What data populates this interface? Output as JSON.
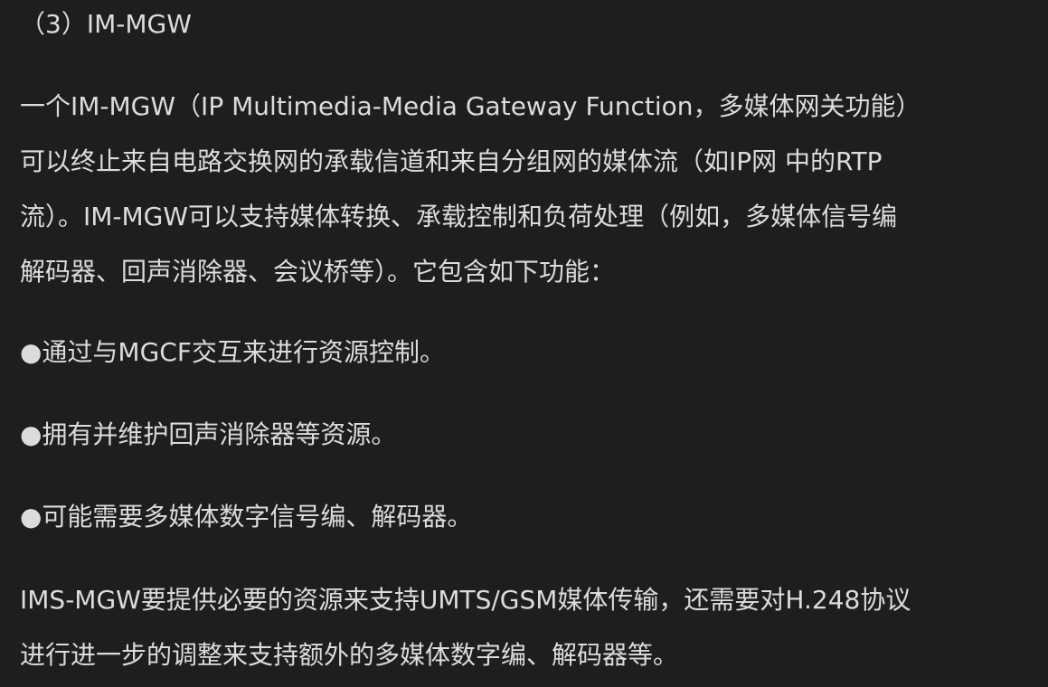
{
  "heading": "（3）IM-MGW",
  "paragraph1": {
    "lines": [
      "一个IM-MGW（IP Multimedia-Media Gateway Function，多媒体网关功能）",
      "可以终止来自电路交换网的承载信道和来自分组网的媒体流（如IP网 中的RTP",
      "流）。IM-MGW可以支持媒体转换、承载控制和负荷处理（例如，多媒体信号编",
      "解码器、回声消除器、会议桥等）。它包含如下功能："
    ]
  },
  "bullets": [
    "●通过与MGCF交互来进行资源控制。",
    "●拥有并维护回声消除器等资源。",
    "●可能需要多媒体数字信号编、解码器。"
  ],
  "paragraph2": {
    "lines": [
      "IMS-MGW要提供必要的资源来支持UMTS/GSM媒体传输，还需要对H.248协议",
      "进行进一步的调整来支持额外的多媒体数字编、解码器等。"
    ]
  },
  "colors": {
    "background": "#1e1e1e",
    "text": "#dcdcdc"
  }
}
